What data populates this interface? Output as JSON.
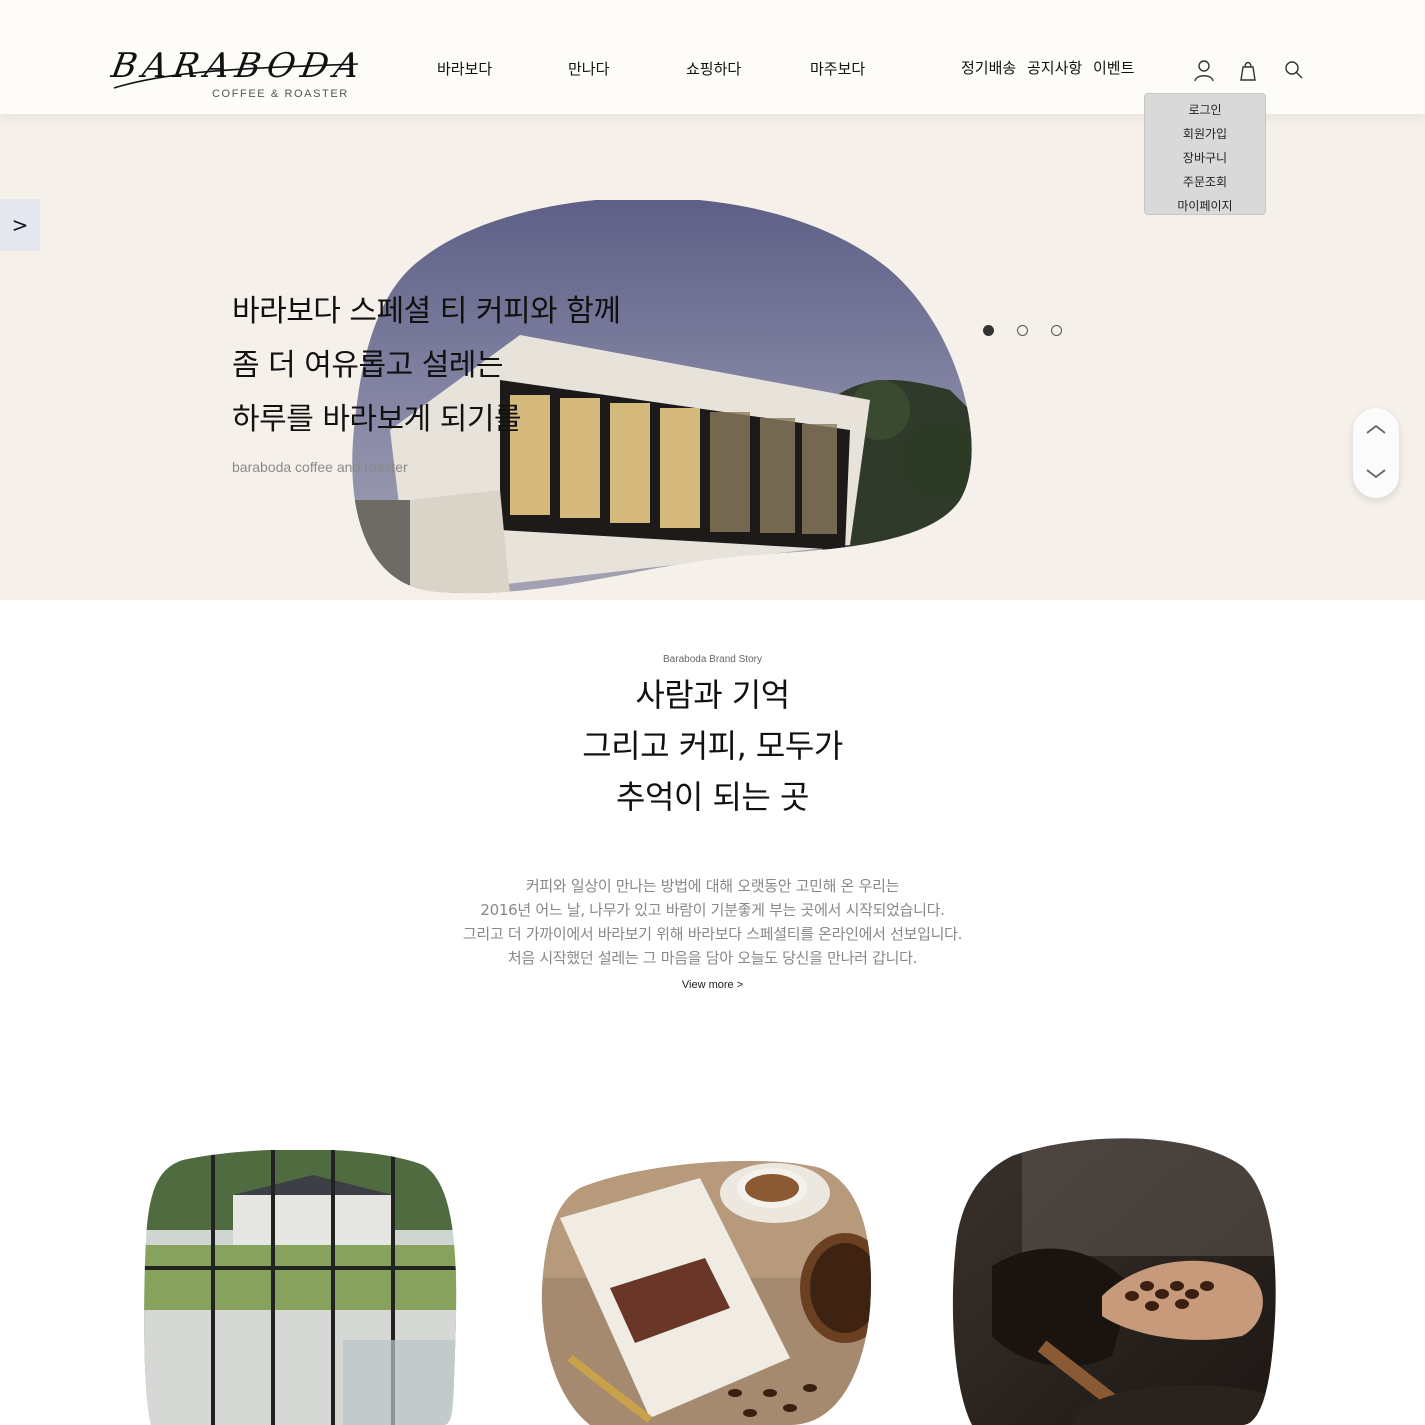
{
  "header": {
    "logo_text": "BARABODA",
    "logo_sub": "COFFEE & ROASTER",
    "nav": [
      "바라보다",
      "만나다",
      "쇼핑하다",
      "마주보다"
    ],
    "util_links": [
      "정기배송",
      "공지사항",
      "이벤트"
    ],
    "icons": [
      "user-icon",
      "shopping-bag-icon",
      "search-icon"
    ]
  },
  "user_menu": {
    "items": [
      "로그인",
      "회원가입",
      "장바구니",
      "주문조회",
      "마이페이지"
    ]
  },
  "hero": {
    "side_tab": ">",
    "lines": [
      "바라보다 스페셜 티 커피와 함께",
      "좀 더 여유롭고 설레는",
      "하루를 바라보게 되기를"
    ],
    "sub": "baraboda coffee and roaster",
    "slides_total": 3,
    "active_slide": 1
  },
  "story": {
    "kicker": "Baraboda Brand Story",
    "title_lines": [
      "사람과 기억",
      "그리고 커피, 모두가",
      "추억이 되는 곳"
    ],
    "body_lines": [
      "커피와 일상이 만나는 방법에 대해 오랫동안 고민해 온 우리는",
      "2016년 어느 날, 나무가 있고 바람이 기분좋게 부는 곳에서 시작되었습니다.",
      "그리고 더 가까이에서 바라보기 위해 바라보다 스페셜티를 온라인에서 선보입니다.",
      "처음 시작했던 설레는 그 마음을 담아 오늘도 당신을 만나러 갑니다."
    ],
    "view_more": "View more >"
  },
  "colors": {
    "header_bg": "#fdfcf9",
    "hero_bg": "#f6f0ea",
    "dropdown_bg": "#d9d9d9",
    "body_text_muted": "#888888"
  }
}
